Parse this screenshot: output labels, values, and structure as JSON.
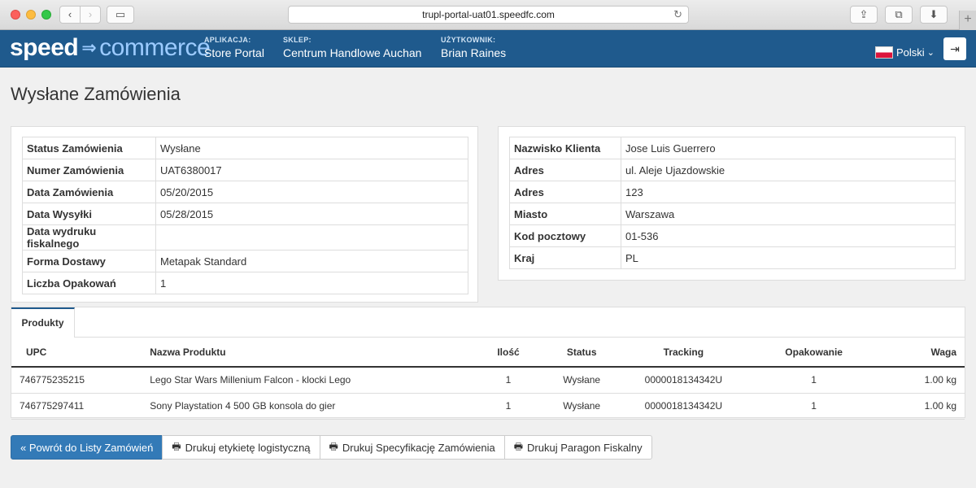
{
  "browser": {
    "url": "trupl-portal-uat01.speedfc.com",
    "icons": {
      "back": "‹",
      "forward": "›",
      "sidebar": "▭",
      "reload": "↻",
      "share": "⇪",
      "tabs": "⧉",
      "download": "⬇",
      "new_tab": "+"
    }
  },
  "header": {
    "logo_part1": "speed",
    "logo_arrow": "⇒",
    "logo_part2": "commerce",
    "app_label": "APLIKACJA:",
    "app_value": "Store Portal",
    "store_label": "SKLEP:",
    "store_value": "Centrum Handlowe Auchan",
    "user_label": "UŻYTKOWNIK:",
    "user_value": "Brian Raines",
    "language": "Polski",
    "language_caret": "⌄",
    "logout_icon": "⇥",
    "brand_color": "#1f5a8d"
  },
  "page": {
    "title": "Wysłane Zamówienia"
  },
  "order": [
    {
      "label": "Status Zamówienia",
      "value": "Wysłane"
    },
    {
      "label": "Numer Zamówienia",
      "value": "UAT6380017"
    },
    {
      "label": "Data Zamówienia",
      "value": "05/20/2015"
    },
    {
      "label": "Data Wysyłki",
      "value": "05/28/2015"
    },
    {
      "label": "Data wydruku fiskalnego",
      "value": ""
    },
    {
      "label": "Forma Dostawy",
      "value": "Metapak Standard"
    },
    {
      "label": "Liczba Opakowań",
      "value": "1"
    }
  ],
  "customer": [
    {
      "label": "Nazwisko Klienta",
      "value": "Jose Luis Guerrero"
    },
    {
      "label": "Adres",
      "value": "ul. Aleje Ujazdowskie"
    },
    {
      "label": "Adres",
      "value": "123"
    },
    {
      "label": "Miasto",
      "value": "Warszawa"
    },
    {
      "label": "Kod pocztowy",
      "value": "01-536"
    },
    {
      "label": "Kraj",
      "value": "PL"
    }
  ],
  "products": {
    "tab_label": "Produkty",
    "columns": [
      "UPC",
      "Nazwa Produktu",
      "Ilość",
      "Status",
      "Tracking",
      "Opakowanie",
      "Waga"
    ],
    "rows": [
      [
        "746775235215",
        "Lego Star Wars Millenium Falcon - klocki Lego",
        "1",
        "Wysłane",
        "0000018134342U",
        "1",
        "1.00 kg"
      ],
      [
        "746775297411",
        "Sony Playstation 4 500 GB konsola do gier",
        "1",
        "Wysłane",
        "0000018134342U",
        "1",
        "1.00 kg"
      ]
    ]
  },
  "actions": {
    "back_label": "« Powrót do Listy Zamówień",
    "print_label_label": "Drukuj etykietę logistyczną",
    "print_spec_label": "Drukuj Specyfikację Zamówienia",
    "print_receipt_label": "Drukuj Paragon Fiskalny",
    "print_icon": "🖶"
  }
}
